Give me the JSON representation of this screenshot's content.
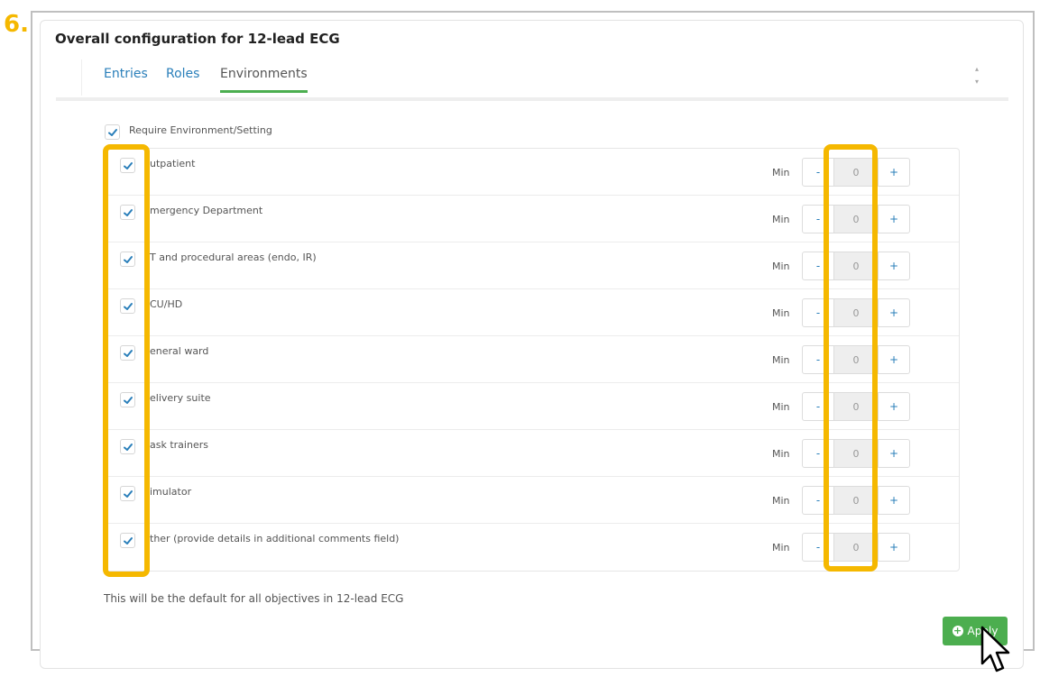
{
  "step_label": "6.",
  "panel": {
    "title": "Overall configuration for 12-lead ECG"
  },
  "tabs": [
    {
      "label": "Entries",
      "active": false
    },
    {
      "label": "Roles",
      "active": false
    },
    {
      "label": "Environments",
      "active": true
    }
  ],
  "require": {
    "label": "Require Environment/Setting",
    "checked": true
  },
  "environments": [
    {
      "label": "utpatient",
      "checked": true,
      "min_label": "Min",
      "value": "0"
    },
    {
      "label": "mergency Department",
      "checked": true,
      "min_label": "Min",
      "value": "0"
    },
    {
      "label": "T and procedural areas (endo, IR)",
      "checked": true,
      "min_label": "Min",
      "value": "0"
    },
    {
      "label": "CU/HD",
      "checked": true,
      "min_label": "Min",
      "value": "0"
    },
    {
      "label": "eneral ward",
      "checked": true,
      "min_label": "Min",
      "value": "0"
    },
    {
      "label": "elivery suite",
      "checked": true,
      "min_label": "Min",
      "value": "0"
    },
    {
      "label": "ask trainers",
      "checked": true,
      "min_label": "Min",
      "value": "0"
    },
    {
      "label": "imulator",
      "checked": true,
      "min_label": "Min",
      "value": "0"
    },
    {
      "label": "ther (provide details in additional comments field)",
      "checked": true,
      "min_label": "Min",
      "value": "0"
    }
  ],
  "stepper": {
    "minus": "-",
    "plus": "+"
  },
  "footer_note": "This will be the default for all objectives in 12-lead ECG",
  "apply_button": {
    "label": "Apply"
  },
  "colors": {
    "accent": "#2a7fba",
    "highlight": "#f5b800",
    "apply": "#4cae4f",
    "tab_underline": "#4caf50"
  }
}
